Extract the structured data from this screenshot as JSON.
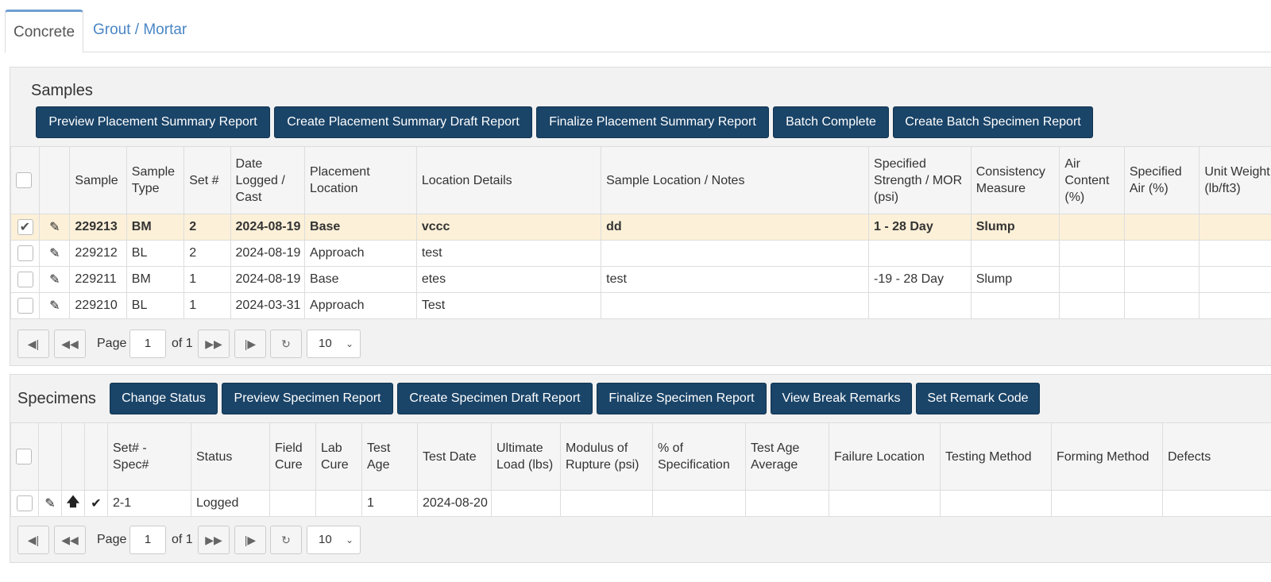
{
  "tabs": [
    {
      "label": "Concrete",
      "active": true
    },
    {
      "label": "Grout / Mortar",
      "active": false
    }
  ],
  "samples": {
    "title": "Samples",
    "buttons": [
      "Preview Placement Summary Report",
      "Create Placement Summary Draft Report",
      "Finalize Placement Summary Report",
      "Batch Complete",
      "Create Batch Specimen Report"
    ],
    "columns": [
      "Sample",
      "Sample Type",
      "Set #",
      "Date Logged / Cast",
      "Placement Location",
      "Location Details",
      "Sample Location / Notes",
      "Specified Strength / MOR (psi)",
      "Consistency Measure",
      "Air Content (%)",
      "Specified Air (%)",
      "Unit Weight (lb/ft3)"
    ],
    "rows": [
      {
        "sample": "229213",
        "type": "BM",
        "set": "2",
        "date": "2024-08-19",
        "placement": "Base",
        "details": "vccc",
        "notes": "dd",
        "strength": "1 - 28 Day",
        "consistency": "Slump",
        "air": "",
        "spec_air": "",
        "unit_weight": "",
        "selected": true
      },
      {
        "sample": "229212",
        "type": "BL",
        "set": "2",
        "date": "2024-08-19",
        "placement": "Approach",
        "details": "test",
        "notes": "",
        "strength": "",
        "consistency": "",
        "air": "",
        "spec_air": "",
        "unit_weight": "",
        "selected": false
      },
      {
        "sample": "229211",
        "type": "BM",
        "set": "1",
        "date": "2024-08-19",
        "placement": "Base",
        "details": "etes",
        "notes": "test",
        "strength": "-19 - 28 Day",
        "consistency": "Slump",
        "air": "",
        "spec_air": "",
        "unit_weight": "",
        "selected": false
      },
      {
        "sample": "229210",
        "type": "BL",
        "set": "1",
        "date": "2024-03-31",
        "placement": "Approach",
        "details": "Test",
        "notes": "",
        "strength": "",
        "consistency": "",
        "air": "",
        "spec_air": "",
        "unit_weight": "",
        "selected": false
      }
    ],
    "pager": {
      "page_label": "Page",
      "page": "1",
      "of_label": "of 1",
      "page_size": "10"
    }
  },
  "specimens": {
    "title": "Specimens",
    "buttons": [
      "Change Status",
      "Preview Specimen Report",
      "Create Specimen Draft Report",
      "Finalize Specimen Report",
      "View Break Remarks",
      "Set Remark Code"
    ],
    "columns": [
      "Set# - Spec#",
      "Status",
      "Field Cure",
      "Lab Cure",
      "Test Age",
      "Test Date",
      "Ultimate Load (lbs)",
      "Modulus of Rupture (psi)",
      "% of Specification",
      "Test Age Average",
      "Failure Location",
      "Testing Method",
      "Forming Method",
      "Defects"
    ],
    "rows": [
      {
        "spec": "2-1",
        "status": "Logged",
        "field_cure": "",
        "lab_cure": "",
        "test_age": "1",
        "test_date": "2024-08-20",
        "ult_load": "",
        "mor": "",
        "pct_spec": "",
        "age_avg": "",
        "failure": "",
        "testing": "",
        "forming": "",
        "defects": ""
      }
    ],
    "pager": {
      "page_label": "Page",
      "page": "1",
      "of_label": "of 1",
      "page_size": "10"
    }
  },
  "icons": {
    "edit": "pencil-icon",
    "up": "arrow-up-icon",
    "check": "checkmark-icon",
    "first": "first-page-icon",
    "prev": "previous-page-icon",
    "next": "next-page-icon",
    "last": "last-page-icon",
    "refresh": "refresh-icon",
    "dropdown": "chevron-down-icon"
  },
  "colors": {
    "button_bg": "#1a4468",
    "tab_active_border": "#6ea0d2",
    "tab_link": "#4a86c5",
    "selected_row": "#fcf0d8"
  }
}
